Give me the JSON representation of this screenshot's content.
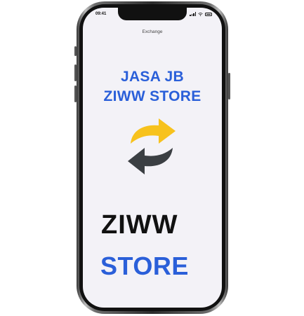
{
  "status_bar": {
    "time": "09:41"
  },
  "screen": {
    "title": "Exchange",
    "headline_line1": "JASA JB",
    "headline_line2": "ZIWW STORE",
    "brand_line1": "ZIWW",
    "brand_line2": "STORE"
  },
  "icons": {
    "exchange": "exchange-arrows-icon",
    "signal": "signal-icon",
    "wifi": "wifi-icon",
    "battery": "battery-icon"
  },
  "colors": {
    "accent_blue": "#2a5fd9",
    "dark_text": "#111111",
    "arrow_yellow": "#f7c21d",
    "arrow_gray": "#3b3f43",
    "screen_bg": "#f3f2f7"
  }
}
